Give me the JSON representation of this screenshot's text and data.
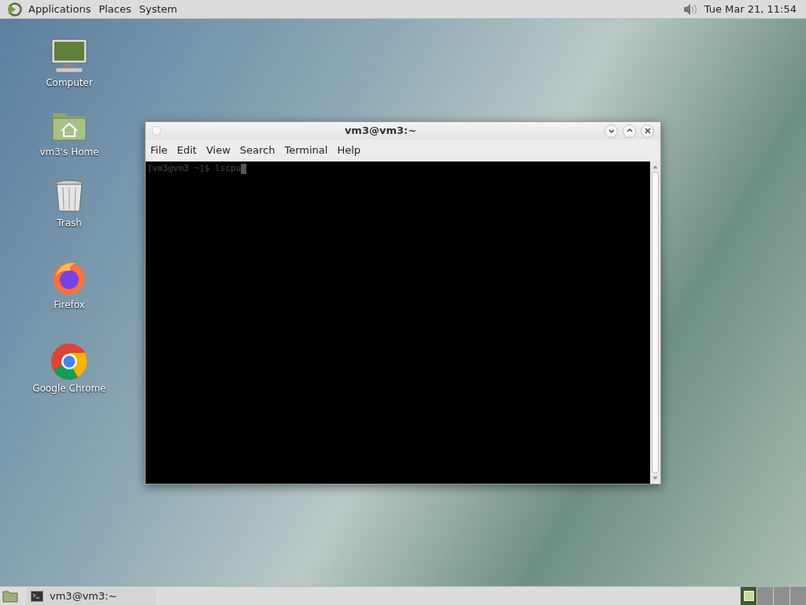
{
  "top_panel": {
    "menus": [
      "Applications",
      "Places",
      "System"
    ],
    "clock": "Tue Mar 21, 11:54"
  },
  "desktop_icons": [
    {
      "kind": "computer",
      "label": "Computer"
    },
    {
      "kind": "home",
      "label": "vm3's Home"
    },
    {
      "kind": "trash",
      "label": "Trash"
    },
    {
      "kind": "firefox",
      "label": "Firefox"
    },
    {
      "kind": "chrome",
      "label": "Google Chrome"
    }
  ],
  "terminal_window": {
    "title": "vm3@vm3:~",
    "menus": [
      "File",
      "Edit",
      "View",
      "Search",
      "Terminal",
      "Help"
    ],
    "lines": [
      "[vm3@vm3 ~]$ lscpu"
    ]
  },
  "bottom_panel": {
    "tasks": [
      {
        "label": "vm3@vm3:~",
        "selected": false
      }
    ],
    "workspaces": [
      {
        "selected": true
      },
      {
        "selected": false
      },
      {
        "selected": false
      },
      {
        "selected": false
      }
    ]
  }
}
